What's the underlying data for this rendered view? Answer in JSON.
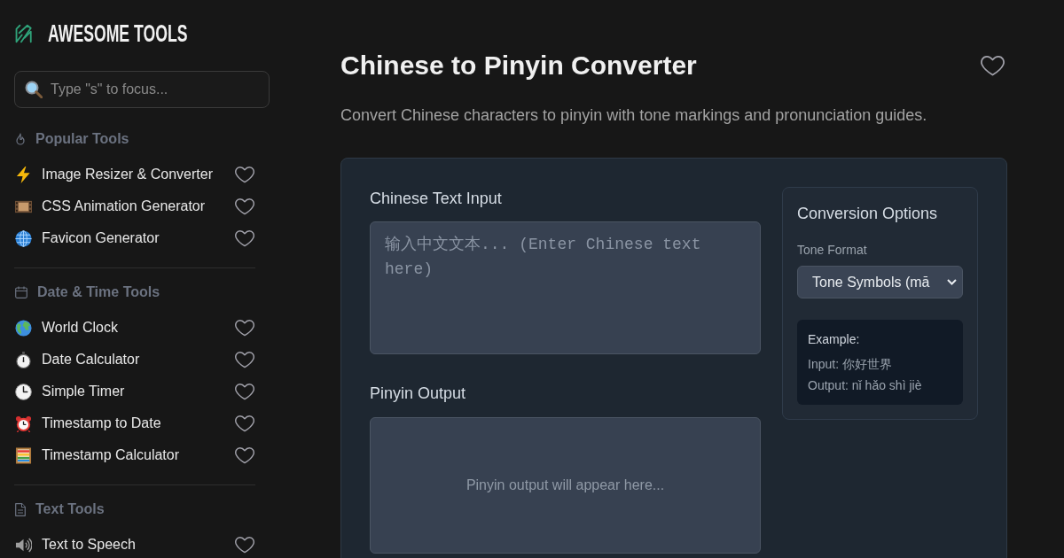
{
  "sidebar": {
    "brand": "AWESOME TOOLS",
    "search": {
      "placeholder": "Type \"s\" to focus..."
    },
    "sections": [
      {
        "title": "Popular Tools",
        "items": [
          {
            "label": "Image Resizer & Converter",
            "favorite": false
          },
          {
            "label": "CSS Animation Generator",
            "favorite": false
          },
          {
            "label": "Favicon Generator",
            "favorite": false
          }
        ]
      },
      {
        "title": "Date & Time Tools",
        "items": [
          {
            "label": "World Clock",
            "favorite": false
          },
          {
            "label": "Date Calculator",
            "favorite": false
          },
          {
            "label": "Simple Timer",
            "favorite": false
          },
          {
            "label": "Timestamp to Date",
            "favorite": false
          },
          {
            "label": "Timestamp Calculator",
            "favorite": false
          }
        ]
      },
      {
        "title": "Text Tools",
        "items": [
          {
            "label": "Text to Speech",
            "favorite": false
          }
        ]
      }
    ]
  },
  "main": {
    "title": "Chinese to Pinyin Converter",
    "favorite": false,
    "description": "Convert Chinese characters to pinyin with tone markings and pronunciation guides.",
    "input": {
      "label": "Chinese Text Input",
      "placeholder": "输入中文文本... (Enter Chinese text here)"
    },
    "output": {
      "label": "Pinyin Output",
      "placeholder": "Pinyin output will appear here..."
    },
    "options": {
      "title": "Conversion Options",
      "tone_format": {
        "label": "Tone Format",
        "value": "Tone Symbols (mā"
      },
      "example": {
        "title": "Example:",
        "lines": [
          "Input: 你好世界",
          "Output: nǐ hǎo shì jiè"
        ]
      }
    }
  }
}
